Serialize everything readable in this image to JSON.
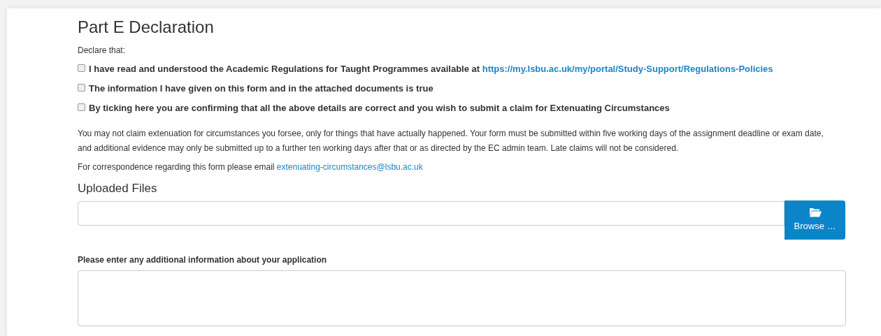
{
  "section_title": "Part E Declaration",
  "intro": "Declare that:",
  "declarations": [
    {
      "text": "I have read and understood the Academic Regulations for Taught Programmes available at",
      "link": "https://my.lsbu.ac.uk/my/portal/Study-Support/Regulations-Policies",
      "checked": false
    },
    {
      "text": "The information I have given on this form and in the attached documents is true",
      "checked": false
    },
    {
      "text": "By ticking here you are confirming that all the above details are correct and you wish to submit a claim for Extenuating Circumstances",
      "checked": false
    }
  ],
  "notice": "You may not claim extenuation for circumstances you forsee, only for things that have actually happened. Your form must be submitted within five working days of the assignment deadline or exam date, and additional evidence may only be submitted up to a further ten working days after that or as directed by the EC admin team. Late claims will not be considered.",
  "correspondence": {
    "text": "For correspondence regarding this form please email",
    "email": "extenuating-circumstances@lsbu.ac.uk"
  },
  "uploads": {
    "title": "Uploaded Files",
    "button": "Browse …"
  },
  "additional_info": {
    "label": "Please enter any additional information about your application"
  }
}
